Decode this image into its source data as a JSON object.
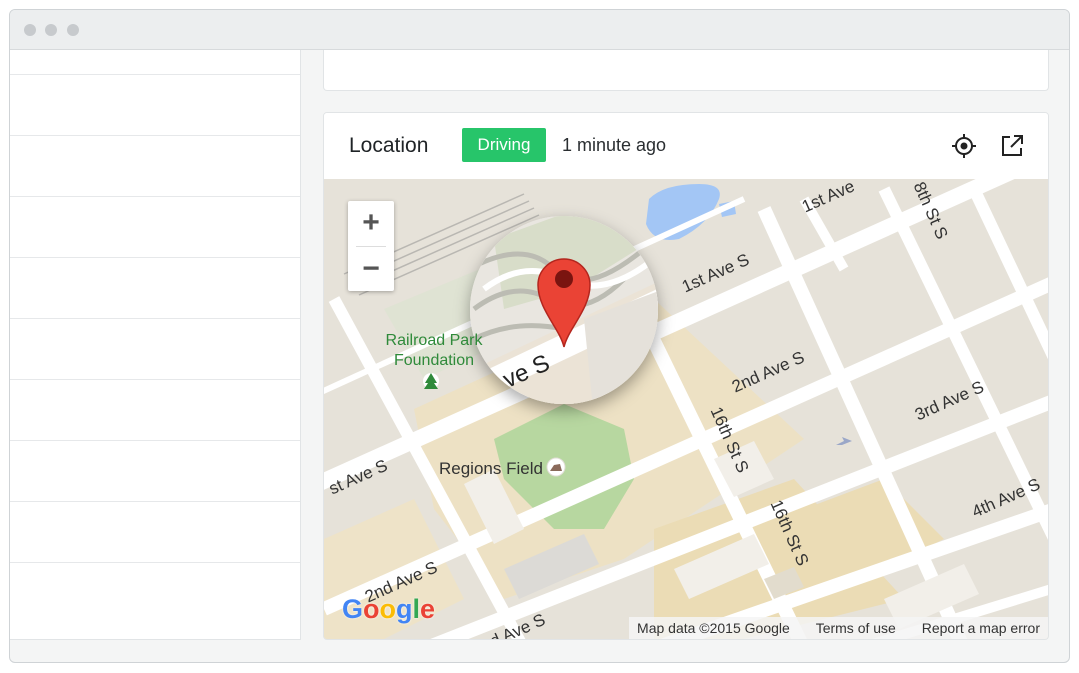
{
  "card": {
    "title": "Location",
    "status_badge": "Driving",
    "timestamp": "1 minute ago",
    "icons": [
      "crosshair-icon",
      "external-link-icon"
    ]
  },
  "map": {
    "zoom_in_label": "+",
    "zoom_out_label": "−",
    "attribution": {
      "map_data": "Map data ©2015 Google",
      "terms": "Terms of use",
      "report": "Report a map error"
    },
    "logo": [
      "G",
      "o",
      "o",
      "g",
      "l",
      "e"
    ],
    "logo_colors": [
      "#4285f4",
      "#ea4335",
      "#fbbc05",
      "#4285f4",
      "#34a853",
      "#ea4335"
    ],
    "labels": {
      "first_ave_top": "1st Ave",
      "first_ave_mid": "1st Ave S",
      "first_ave_magnified": "ve S",
      "first_ave_left": "st Ave S",
      "second_ave_right": "2nd Ave S",
      "second_ave_left": "2nd Ave S",
      "third_ave_right": "3rd Ave S",
      "third_ave_bottom": "rd Ave S",
      "fourth_ave": "4th Ave S",
      "sixteenth_top": "16th St S",
      "sixteenth_bottom": "16th St S",
      "eighteenth": "8th St S",
      "park_line1": "Railroad Park",
      "park_line2": "Foundation",
      "field": "Regions Field"
    },
    "colors": {
      "marker": "#ea4335",
      "park": "#b7d7a0",
      "water": "#a3c6f5",
      "badge": "#27c56a"
    }
  }
}
